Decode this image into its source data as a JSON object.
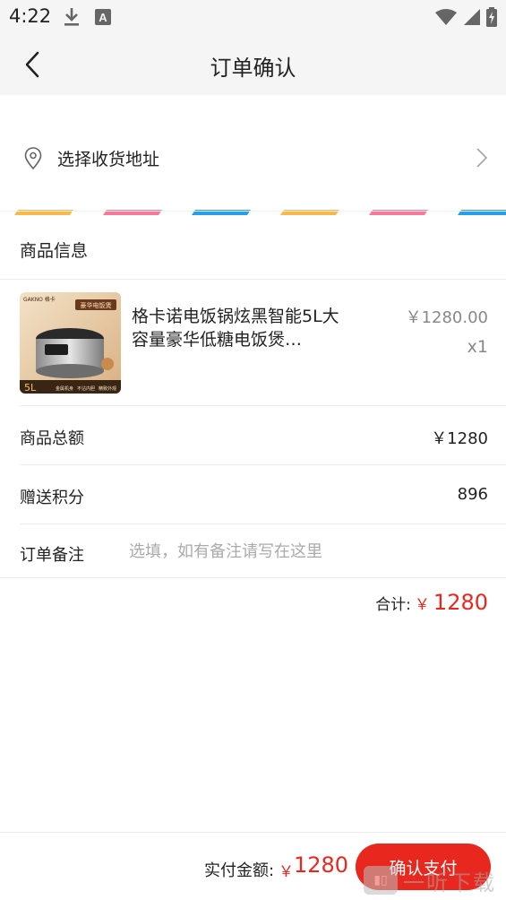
{
  "status_bar": {
    "time": "4:22",
    "icons": [
      "download-icon",
      "a-letter-icon",
      "wifi-icon",
      "signal-icon",
      "battery-icon"
    ]
  },
  "header": {
    "title": "订单确认",
    "back_icon": "chevron-left-icon"
  },
  "address": {
    "label": "选择收货地址",
    "icon": "location-pin-icon"
  },
  "stripe_colors": [
    "#f7b94d",
    "#f57a9a",
    "#2a9de8"
  ],
  "goods_section": {
    "title": "商品信息",
    "items": [
      {
        "name": "格卡诺电饭锅炫黑智能5L大容量豪华低糖电饭煲…",
        "price": "￥1280.00",
        "qty": "x1",
        "thumb": {
          "brand": "GAKNO 格卡",
          "banner": "豪华电饭煲",
          "capacity": "5L",
          "features": [
            "金属机身",
            "不沾内胆",
            "精致外观"
          ]
        }
      }
    ]
  },
  "summary": {
    "goods_total_label": "商品总额",
    "goods_total_value": "￥1280",
    "points_label": "赠送积分",
    "points_value": "896",
    "remark_label": "订单备注",
    "remark_placeholder": "选填，如有备注请写在这里"
  },
  "total": {
    "label": "合计:",
    "currency": "￥",
    "amount": "1280"
  },
  "footer": {
    "pay_label": "实付金额:",
    "currency": "￥",
    "amount": "1280",
    "confirm_label": "确认支付"
  },
  "colors": {
    "accent": "#e8281e",
    "bar_bg": "#f5f5f5"
  },
  "watermark": {
    "text": "一听下载"
  }
}
